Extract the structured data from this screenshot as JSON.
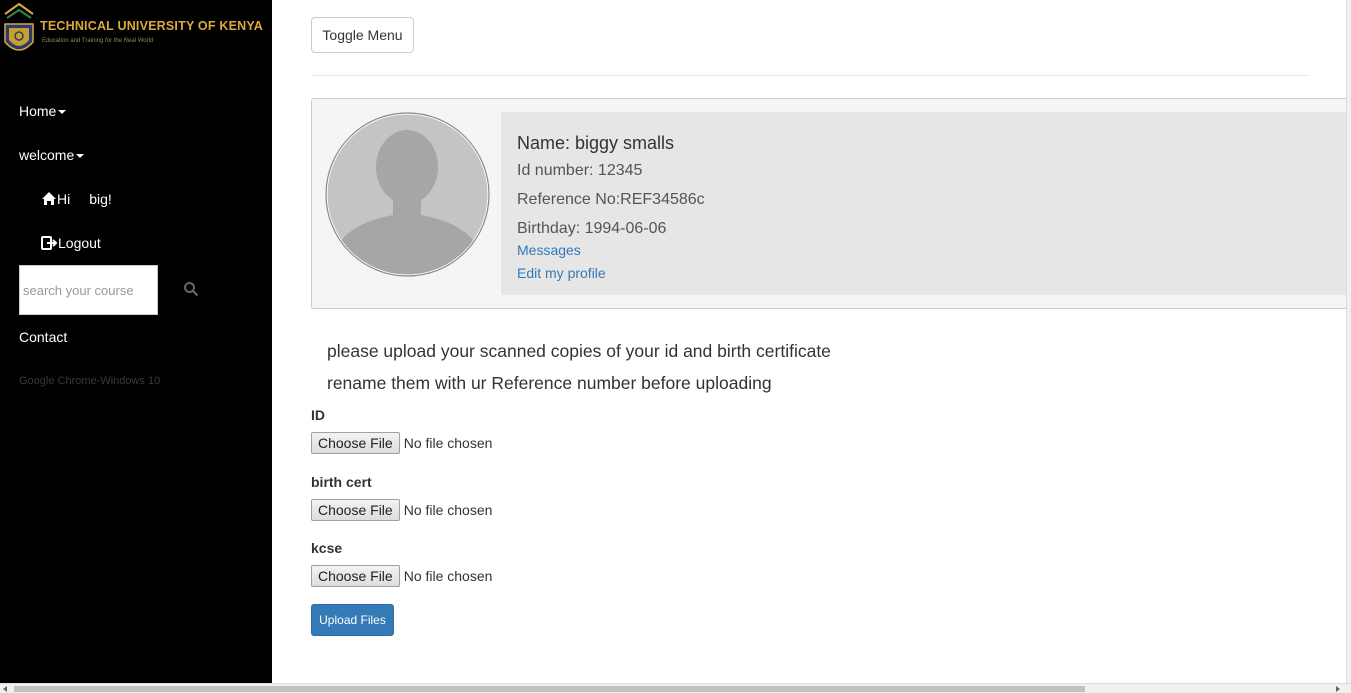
{
  "sidebar": {
    "logo_title": "TECHNICAL UNIVERSITY OF KENYA",
    "logo_subtitle": "Education and Training for the Real World",
    "nav": {
      "home": "Home",
      "welcome": "welcome",
      "hi": "Hi",
      "user": "big!",
      "logout": "Logout",
      "contact": "Contact"
    },
    "search_placeholder": "search your course",
    "browser_note": "Google Chrome-Windows 10"
  },
  "main": {
    "toggle_label": "Toggle Menu",
    "profile": {
      "name": "Name: biggy smalls",
      "id_number": "Id number: 12345",
      "reference": "Reference No:REF34586c",
      "birthday": "Birthday: 1994-06-06",
      "messages_link": "Messages",
      "edit_link": "Edit my profile"
    },
    "instructions": [
      "please upload your scanned copies of your id and birth certificate",
      "rename them with ur Reference number before uploading"
    ],
    "uploads": [
      {
        "label": "ID",
        "button": "Choose File",
        "status": "No file chosen"
      },
      {
        "label": "birth cert",
        "button": "Choose File",
        "status": "No file chosen"
      },
      {
        "label": "kcse",
        "button": "Choose File",
        "status": "No file chosen"
      }
    ],
    "submit_label": "Upload Files"
  },
  "colors": {
    "sidebar_bg": "#000000",
    "logo_gold": "#d9a93b",
    "link_blue": "#337ab7",
    "primary_button": "#337ab7"
  },
  "icons": [
    "home-icon",
    "logout-icon",
    "search-icon",
    "avatar-silhouette-icon"
  ]
}
